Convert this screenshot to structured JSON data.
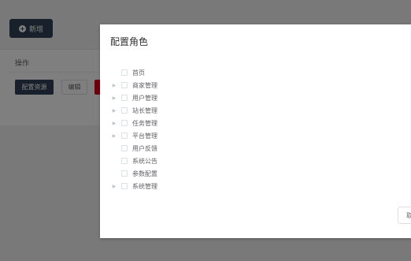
{
  "toolbar": {
    "add_label": "新增"
  },
  "card": {
    "ops_label": "操作",
    "config_label": "配置资源",
    "edit_label": "编辑"
  },
  "dialog": {
    "title": "配置角色",
    "cancel_label": "取",
    "tree": [
      {
        "label": "首页",
        "expandable": false
      },
      {
        "label": "商家管理",
        "expandable": true
      },
      {
        "label": "用户管理",
        "expandable": true
      },
      {
        "label": "站长管理",
        "expandable": true
      },
      {
        "label": "任务管理",
        "expandable": true
      },
      {
        "label": "平台管理",
        "expandable": true
      },
      {
        "label": "用户反馈",
        "expandable": false
      },
      {
        "label": "系统公告",
        "expandable": false
      },
      {
        "label": "参数配置",
        "expandable": false
      },
      {
        "label": "系统管理",
        "expandable": true
      }
    ]
  },
  "colors": {
    "primary": "#304156",
    "danger": "#d9001b",
    "mask": "#7f7f7f"
  }
}
